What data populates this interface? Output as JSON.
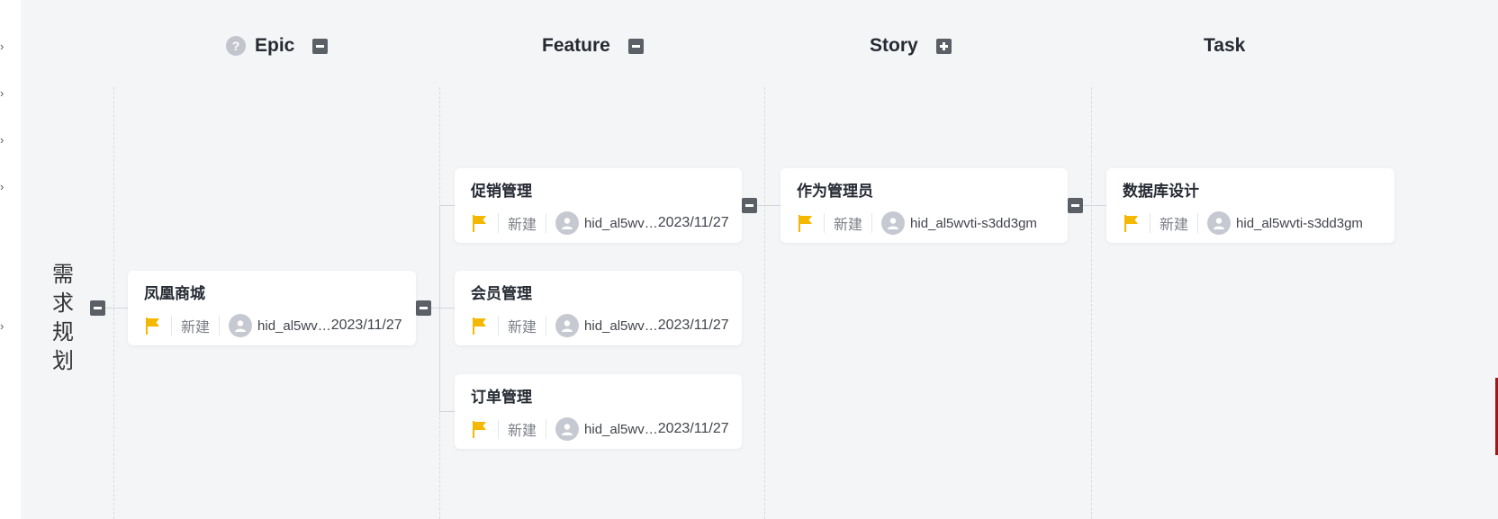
{
  "columns": {
    "epic": {
      "label": "Epic",
      "help_icon": "?",
      "toggle": "collapse"
    },
    "feature": {
      "label": "Feature",
      "toggle": "collapse"
    },
    "story": {
      "label": "Story",
      "toggle": "expand"
    },
    "task": {
      "label": "Task"
    }
  },
  "group": {
    "label": "需求规划"
  },
  "cards": {
    "epic_main": {
      "title": "凤凰商城",
      "status": "新建",
      "owner": "hid_al5wv…",
      "date": "2023/11/27"
    },
    "feature_promo": {
      "title": "促销管理",
      "status": "新建",
      "owner": "hid_al5wv…",
      "date": "2023/11/27"
    },
    "feature_member": {
      "title": "会员管理",
      "status": "新建",
      "owner": "hid_al5wv…",
      "date": "2023/11/27"
    },
    "feature_order": {
      "title": "订单管理",
      "status": "新建",
      "owner": "hid_al5wv…",
      "date": "2023/11/27"
    },
    "story_admin": {
      "title": "作为管理员",
      "status": "新建",
      "owner": "hid_al5wvti-s3dd3gm"
    },
    "task_db": {
      "title": "数据库设计",
      "status": "新建",
      "owner": "hid_al5wvti-s3dd3gm"
    }
  },
  "left_nav": {
    "chevron": "›"
  },
  "colors": {
    "board_bg": "#f4f5f7",
    "flag": "#f5b800",
    "toggle": "#5b5f66",
    "title": "#262a33"
  },
  "icons": {
    "flag": "flag-icon",
    "avatar": "user-avatar-icon",
    "help": "help-icon",
    "collapse": "minus-square-icon",
    "expand": "plus-square-icon",
    "chevron": "chevron-right-icon"
  }
}
